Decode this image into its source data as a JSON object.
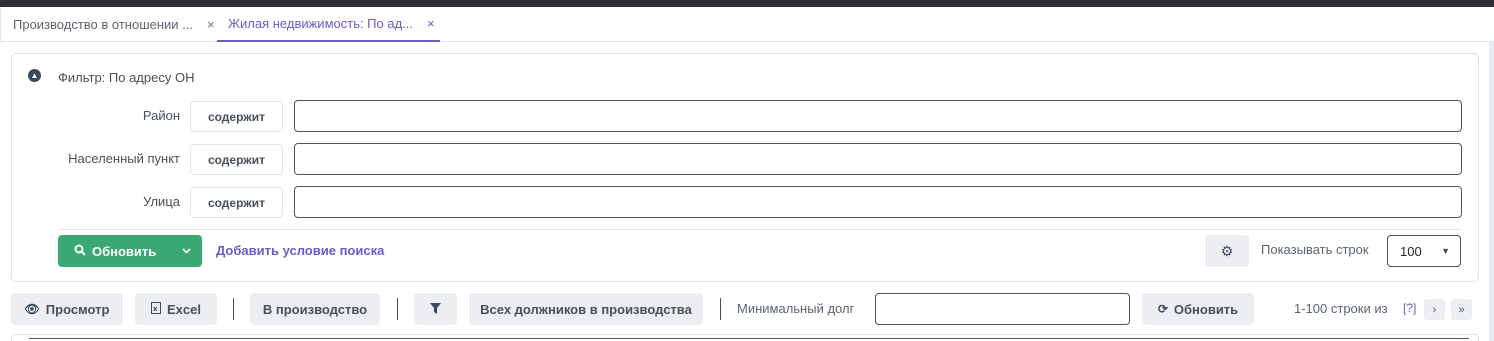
{
  "tabs": [
    {
      "label": "Производство в отношении ...",
      "close": "×"
    },
    {
      "label": "Жилая недвижимость: По ад...",
      "close": "×"
    }
  ],
  "filter": {
    "title": "Фильтр: По адресу ОН",
    "collapse_icon": "chevron-up-circle-icon",
    "rows": [
      {
        "label": "Район",
        "operator": "содержит",
        "value": ""
      },
      {
        "label": "Населенный пункт",
        "operator": "содержит",
        "value": ""
      },
      {
        "label": "Улица",
        "operator": "содержит",
        "value": ""
      }
    ],
    "refresh_label": "Обновить",
    "add_condition": "Добавить условие поиска",
    "rows_label": "Показывать строк",
    "rows_value": "100"
  },
  "toolbar": {
    "view_label": "Просмотр",
    "excel_label": "Excel",
    "to_production_label": "В производство",
    "all_debtors_label": "Всех должников в производства",
    "min_debt_label": "Минимальный долг",
    "min_debt_value": "",
    "refresh_label": "Обновить",
    "pager_text": "1-100 строки из",
    "pager_help": "[?]",
    "next": "›",
    "last": "»"
  },
  "colors": {
    "accent": "#6f58c9",
    "primary_button": "#3aa872",
    "secondary_button": "#eceef1"
  }
}
